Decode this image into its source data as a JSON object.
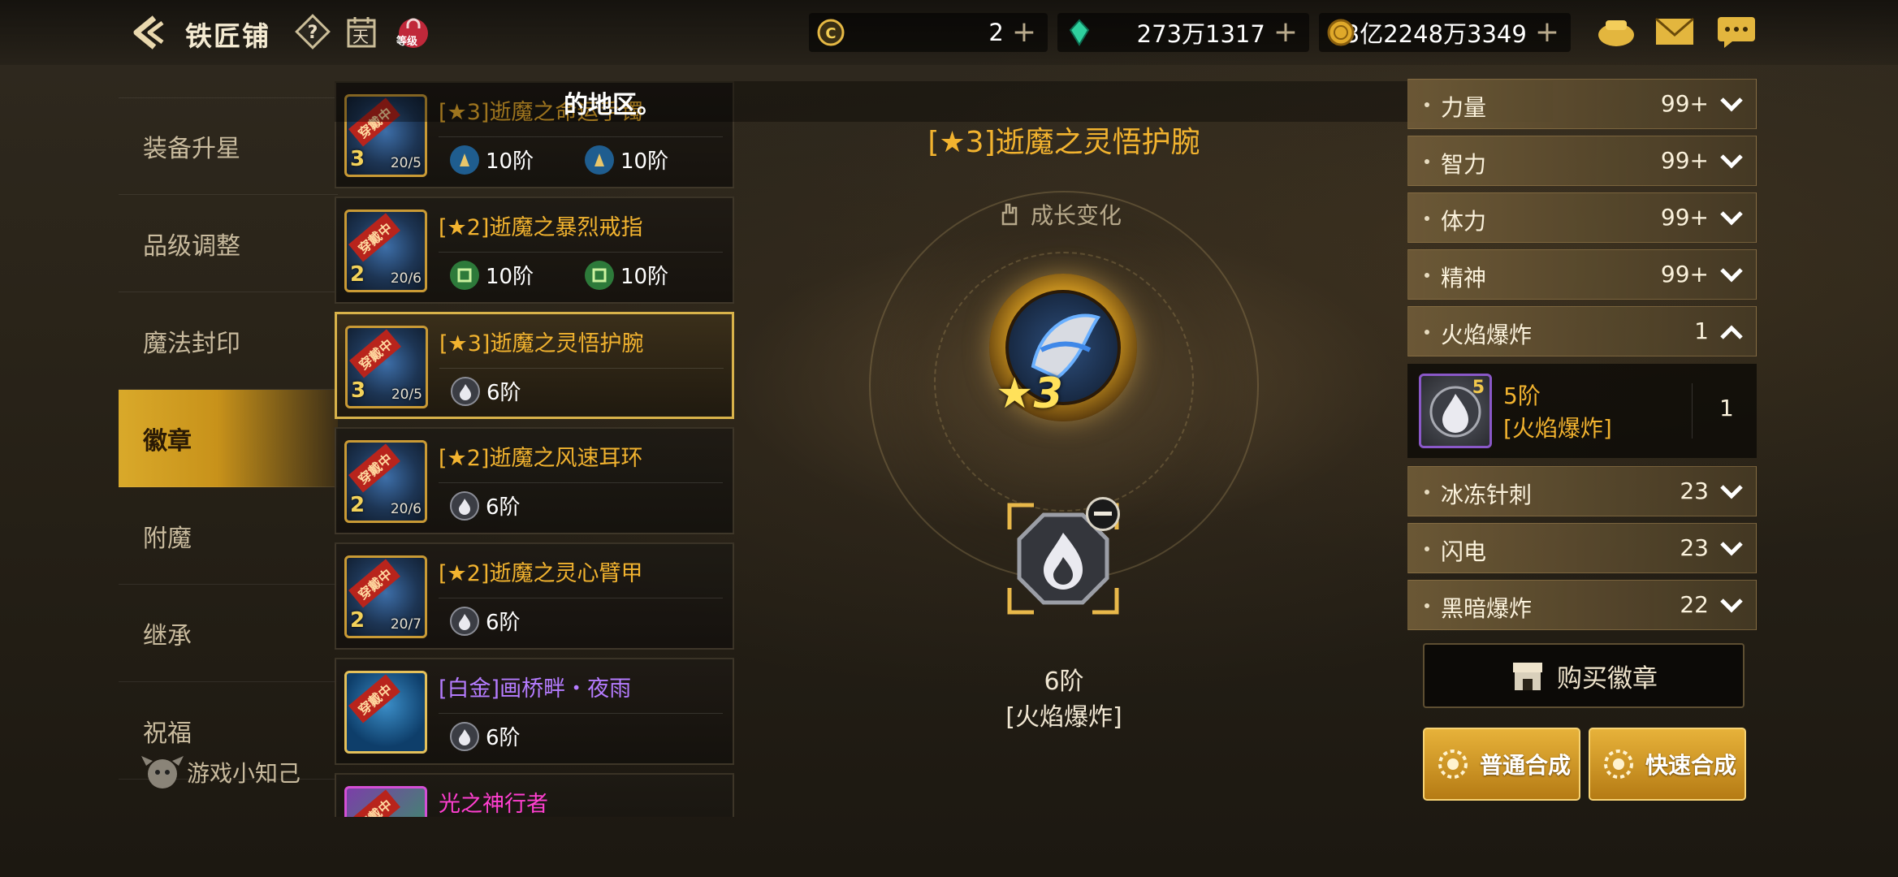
{
  "header": {
    "title": "铁匠铺",
    "resources": [
      {
        "name": "cera-coin",
        "value": "2"
      },
      {
        "name": "crystal",
        "value": "273万1317"
      },
      {
        "name": "gold",
        "value": "3亿2248万3349"
      }
    ],
    "level_badge": "等级",
    "calendar_char": "天"
  },
  "nav": {
    "items": [
      "装备升星",
      "品级调整",
      "魔法封印",
      "徽章",
      "附魔",
      "继承",
      "祝福"
    ],
    "active_index": 3,
    "tips": "游戏小知己"
  },
  "overlay_text": "的地区。",
  "list": {
    "rows": [
      {
        "name": "[★3]逝魔之命运手镯",
        "star": "3",
        "progress": "20/5",
        "badge": "穿戴中",
        "slots": [
          "10阶",
          "10阶"
        ],
        "color": "gold"
      },
      {
        "name": "[★2]逝魔之暴烈戒指",
        "star": "2",
        "progress": "20/6",
        "badge": "穿戴中",
        "slots": [
          "10阶",
          "10阶"
        ],
        "color": "gold"
      },
      {
        "name": "[★3]逝魔之灵悟护腕",
        "star": "3",
        "progress": "20/5",
        "badge": "穿戴中",
        "slots": [
          "6阶"
        ],
        "color": "gold"
      },
      {
        "name": "[★2]逝魔之风速耳环",
        "star": "2",
        "progress": "20/6",
        "badge": "穿戴中",
        "slots": [
          "6阶"
        ],
        "color": "gold"
      },
      {
        "name": "[★2]逝魔之灵心臂甲",
        "star": "2",
        "progress": "20/7",
        "badge": "穿戴中",
        "slots": [
          "6阶"
        ],
        "color": "gold"
      },
      {
        "name": "[白金]画桥畔・夜雨",
        "star": "",
        "progress": "",
        "badge": "穿戴中",
        "slots": [
          "6阶"
        ],
        "color": "purple"
      },
      {
        "name": "光之神行者",
        "star": "",
        "progress": "",
        "badge": "穿戴中",
        "slots": [],
        "color": "magenta"
      }
    ],
    "selected_index": 2
  },
  "detail": {
    "title": "[★3]逝魔之灵悟护腕",
    "growth_label": "成长变化",
    "star_level": "3",
    "slot_level": "6阶",
    "slot_type": "[火焰爆炸]"
  },
  "stats": {
    "items": [
      {
        "label": "力量",
        "value": "99+",
        "expanded": false
      },
      {
        "label": "智力",
        "value": "99+",
        "expanded": false
      },
      {
        "label": "体力",
        "value": "99+",
        "expanded": false
      },
      {
        "label": "精神",
        "value": "99+",
        "expanded": false
      },
      {
        "label": "火焰爆炸",
        "value": "1",
        "expanded": true
      },
      {
        "label": "冰冻针刺",
        "value": "23",
        "expanded": false
      },
      {
        "label": "闪电",
        "value": "23",
        "expanded": false
      },
      {
        "label": "黑暗爆炸",
        "value": "22",
        "expanded": false
      }
    ],
    "sub": {
      "gem_level": "5",
      "line1": "5阶",
      "line2": "[火焰爆炸]",
      "count": "1"
    }
  },
  "buttons": {
    "buy": "购买徽章",
    "normal_combine": "普通合成",
    "quick_combine": "快速合成"
  },
  "colors": {
    "accent": "#f2b32f",
    "active_nav": "#d9a92a",
    "purple_name": "#b57cff",
    "magenta_name": "#ff3fd0"
  }
}
